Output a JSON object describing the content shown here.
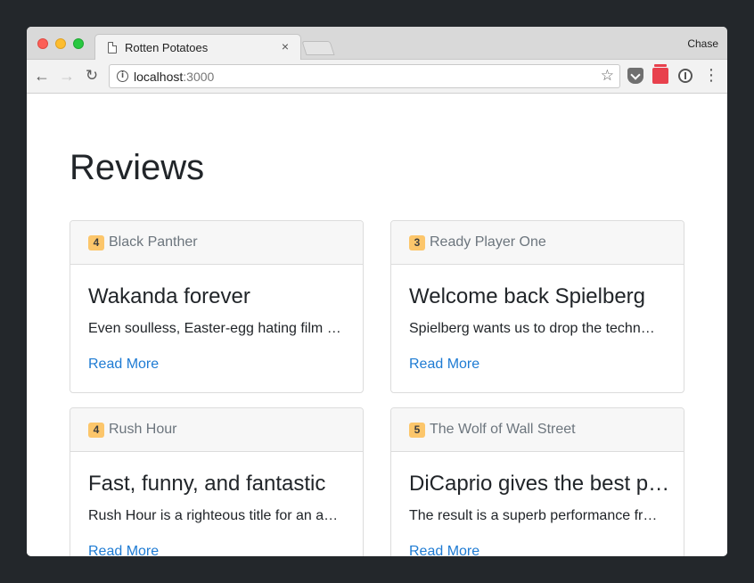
{
  "browser": {
    "tab_title": "Rotten Potatoes",
    "tab_close": "×",
    "profile_name": "Chase",
    "url_host": "localhost",
    "url_port": ":3000",
    "info_glyph": "i",
    "star_glyph": "☆",
    "back_glyph": "←",
    "forward_glyph": "→",
    "reload_glyph": "↻",
    "menu_glyph": "⋮"
  },
  "page": {
    "title": "Reviews"
  },
  "reviews": [
    {
      "rating": "4",
      "movie": "Black Panther",
      "title": "Wakanda forever",
      "excerpt": "Even soulless, Easter-egg hating film …",
      "link": "Read More"
    },
    {
      "rating": "3",
      "movie": "Ready Player One",
      "title": "Welcome back Spielberg",
      "excerpt": "Spielberg wants us to drop the techn…",
      "link": "Read More"
    },
    {
      "rating": "4",
      "movie": "Rush Hour",
      "title": "Fast, funny, and fantastic",
      "excerpt": "Rush Hour is a righteous title for an a…",
      "link": "Read More"
    },
    {
      "rating": "5",
      "movie": "The Wolf of Wall Street",
      "title": "DiCaprio gives the best p…",
      "excerpt": "The result is a superb performance fr…",
      "link": "Read More"
    }
  ],
  "colors": {
    "badge": "#fcc66b",
    "link": "#1e7bd3",
    "backdrop": "#23272b"
  }
}
